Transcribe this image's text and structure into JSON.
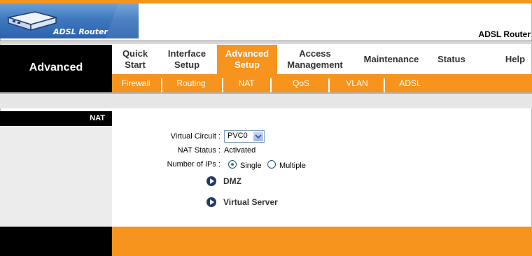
{
  "header": {
    "logo_text": "ADSL Router",
    "title": "ADSL Router"
  },
  "section": "Advanced",
  "tabs": [
    {
      "label1": "Quick",
      "label2": "Start",
      "active": false
    },
    {
      "label1": "Interface",
      "label2": "Setup",
      "active": false
    },
    {
      "label1": "Advanced",
      "label2": "Setup",
      "active": true
    },
    {
      "label1": "Access",
      "label2": "Management",
      "active": false
    },
    {
      "label1": "Maintenance",
      "label2": "",
      "active": false
    },
    {
      "label1": "Status",
      "label2": "",
      "active": false
    },
    {
      "label1": "Help",
      "label2": "",
      "active": false
    }
  ],
  "subtabs": [
    "Firewall",
    "Routing",
    "NAT",
    "QoS",
    "VLAN",
    "ADSL"
  ],
  "page_label": "NAT",
  "form": {
    "vc_label": "Virtual Circuit :",
    "vc_value": "PVC0",
    "status_label": "NAT Status :",
    "status_value": "Activated",
    "ips_label": "Number of IPs :",
    "opt_single": "Single",
    "opt_multiple": "Multiple",
    "selected": "Single"
  },
  "links": {
    "dmz": "DMZ",
    "virtual_server": "Virtual Server"
  },
  "colors": {
    "accent": "#f7941d",
    "sidebar": "#000000",
    "logo_blue": "#3f77bf"
  }
}
